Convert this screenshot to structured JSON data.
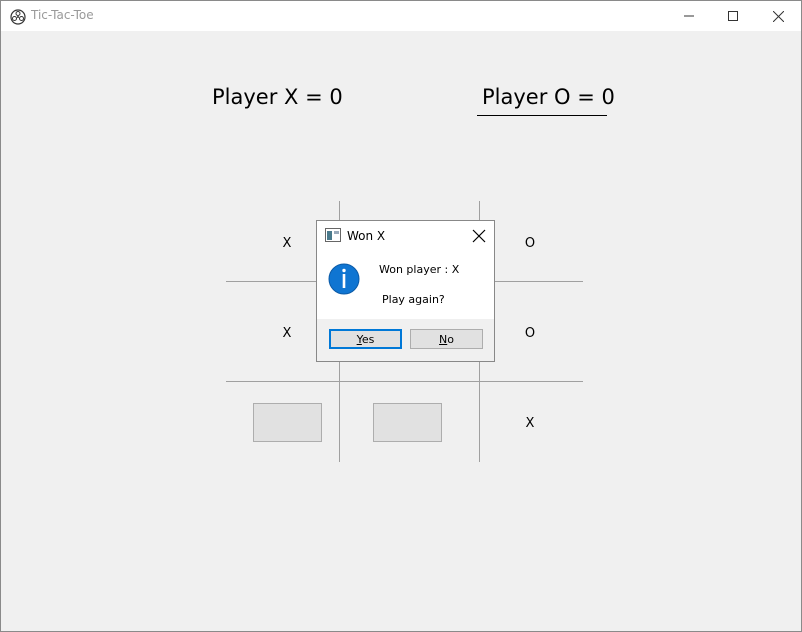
{
  "window": {
    "title": "Tic-Tac-Toe",
    "icon": "game-wheel-icon"
  },
  "titlebar_buttons": {
    "minimize": "minimize-icon",
    "maximize": "maximize-icon",
    "close": "close-icon"
  },
  "scores": {
    "player_x": "Player X = 0",
    "player_o": "Player O = 0"
  },
  "board": {
    "cells": [
      {
        "row": 1,
        "col": 1,
        "value": "X"
      },
      {
        "row": 1,
        "col": 2,
        "value": ""
      },
      {
        "row": 1,
        "col": 3,
        "value": "O"
      },
      {
        "row": 2,
        "col": 1,
        "value": "X"
      },
      {
        "row": 2,
        "col": 2,
        "value": ""
      },
      {
        "row": 2,
        "col": 3,
        "value": "O"
      },
      {
        "row": 3,
        "col": 1,
        "value": ""
      },
      {
        "row": 3,
        "col": 2,
        "value": ""
      },
      {
        "row": 3,
        "col": 3,
        "value": "X"
      }
    ]
  },
  "dialog": {
    "title": "Won X",
    "message": "Won player : X",
    "question": "Play again?",
    "yes_mnemonic": "Y",
    "yes_rest": "es",
    "no_mnemonic": "N",
    "no_rest": "o",
    "icon": "information-icon"
  },
  "colors": {
    "accent": "#0078d7",
    "window_bg": "#f0f0f0"
  }
}
